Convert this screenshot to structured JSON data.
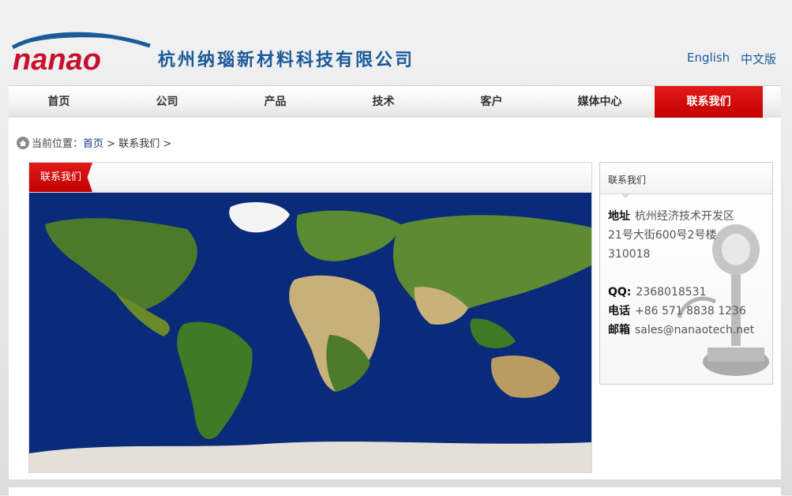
{
  "header": {
    "logo_text": "杭州纳瑙新材料科技有限公司",
    "logo_mark": "nanao",
    "lang_en": "English",
    "lang_cn": "中文版"
  },
  "nav": {
    "items": [
      "首页",
      "公司",
      "产品",
      "技术",
      "客户",
      "媒体中心",
      "联系我们"
    ],
    "active_index": 6
  },
  "breadcrumb": {
    "prefix": "当前位置：",
    "home": "首页",
    "sep": ">",
    "current": "联系我们",
    "trail_end": ">"
  },
  "main": {
    "tab": "联系我们"
  },
  "contact": {
    "title": "联系我们",
    "address_label": "地址",
    "address_line1": "杭州经济技术开发区",
    "address_line2": "21号大街600号2号楼",
    "postcode": "310018",
    "qq_label": "QQ:",
    "qq": "2368018531",
    "phone_label": "电话",
    "phone": "+86 571 8838 1236",
    "email_label": "邮箱",
    "email": "sales@nanaotech.net"
  },
  "colors": {
    "brand_blue": "#1a5a9a",
    "accent_red": "#d40000"
  }
}
